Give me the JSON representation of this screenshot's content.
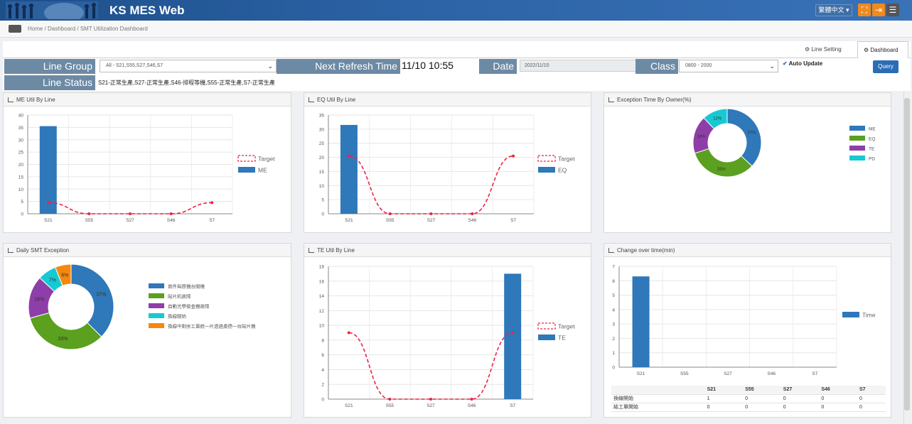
{
  "app": {
    "title": "KS MES Web",
    "language": "繁體中文",
    "colors": {
      "header": "#2c63a6",
      "bar": "#2f78b9",
      "target": "#ee2244",
      "label": "#6d8aa5"
    }
  },
  "breadcrumb": "Home /  Dashboard /  SMT Utilization Dashboard",
  "tabs": [
    {
      "label": "Line Setting",
      "icon": "gear-icon"
    },
    {
      "label": "Dashboard",
      "icon": "gear-icon"
    }
  ],
  "filters": {
    "line_group_label": "Line Group",
    "line_group_value": "All - S21,S55,S27,S46,S7",
    "next_refresh_label": "Next Refresh Time",
    "next_refresh_value": "11/10 10:55",
    "date_label": "Date",
    "date_value": "2022/11/10",
    "class_label": "Class",
    "class_value": "0800 - 2000",
    "auto_update_label": "Auto Update",
    "query_label": "Query",
    "line_status_label": "Line Status",
    "line_status_value": "S21-正常生產,S27-正常生產,S46-排程等機,S55-正常生產,S7-正常生產"
  },
  "panels": {
    "me_title": "ME Util By Line",
    "eq_title": "EQ Util By Line",
    "exc_title": "Exception Time By Owner(%)",
    "daily_title": "Daily SMT Exception",
    "te_title": "TE Util By Line",
    "cot_title": "Change over time(min)"
  },
  "chart_data": [
    {
      "type": "bar",
      "id": "me",
      "categories": [
        "S21",
        "S55",
        "S27",
        "S46",
        "S7"
      ],
      "series": [
        {
          "name": "ME",
          "kind": "bar",
          "values": [
            35.5,
            0,
            0,
            0,
            0
          ]
        },
        {
          "name": "Target",
          "kind": "line",
          "values": [
            4.5,
            0,
            0,
            0,
            4.5
          ]
        }
      ],
      "yticks": [
        "0",
        "5",
        "10",
        "15",
        "20",
        "25",
        "30",
        "35",
        "40"
      ],
      "ylim": [
        0,
        40
      ]
    },
    {
      "type": "bar",
      "id": "eq",
      "categories": [
        "S21",
        "S55",
        "S27",
        "S46",
        "S7"
      ],
      "series": [
        {
          "name": "EQ",
          "kind": "bar",
          "values": [
            31.5,
            0,
            0,
            0,
            0
          ]
        },
        {
          "name": "Target",
          "kind": "line",
          "values": [
            20.5,
            0,
            0,
            0,
            20.5
          ]
        }
      ],
      "yticks": [
        "0",
        "5",
        "10",
        "15",
        "20",
        "25",
        "30",
        "35"
      ],
      "ylim": [
        0,
        35
      ]
    },
    {
      "type": "pie",
      "id": "exc",
      "labels": [
        "ME",
        "EQ",
        "TE",
        "PD"
      ],
      "values": [
        37,
        33,
        18,
        12
      ],
      "slice_labels": [
        "37%",
        "33%",
        "18%",
        "12%"
      ],
      "colors": [
        "#2f78b9",
        "#5ba01e",
        "#8e3ea8",
        "#17c9d3"
      ]
    },
    {
      "type": "pie",
      "id": "daily",
      "labels": [
        "首件與原機台開機",
        "貼片机故障",
        "自動光學檢查機故障",
        "換線開始",
        "換線中剩余工單統一片透過奧德一台貼片機"
      ],
      "values": [
        37,
        33,
        16,
        7,
        6
      ],
      "slice_labels": [
        "37%",
        "33%",
        "16%",
        "7%",
        "6%"
      ],
      "colors": [
        "#2f78b9",
        "#5ba01e",
        "#8e3ea8",
        "#17c9d3",
        "#f7870d"
      ]
    },
    {
      "type": "bar",
      "id": "te",
      "categories": [
        "S21",
        "S55",
        "S27",
        "S46",
        "S7"
      ],
      "series": [
        {
          "name": "TE",
          "kind": "bar",
          "values": [
            0,
            0,
            0,
            0,
            17
          ]
        },
        {
          "name": "Target",
          "kind": "line",
          "values": [
            9,
            0,
            0,
            0,
            9
          ]
        }
      ],
      "yticks": [
        "0",
        "2",
        "4",
        "6",
        "8",
        "10",
        "12",
        "14",
        "16",
        "18"
      ],
      "ylim": [
        0,
        18
      ]
    },
    {
      "type": "bar",
      "id": "cot",
      "categories": [
        "S21",
        "S55",
        "S27",
        "S46",
        "S7"
      ],
      "series": [
        {
          "name": "Time",
          "kind": "bar",
          "values": [
            6.3,
            0,
            0,
            0,
            0
          ]
        }
      ],
      "yticks": [
        "0",
        "1",
        "2",
        "3",
        "4",
        "5",
        "6",
        "7"
      ],
      "ylim": [
        0,
        7
      ]
    }
  ],
  "cot_table": {
    "headers": [
      "",
      "S21",
      "S55",
      "S27",
      "S46",
      "S7"
    ],
    "rows": [
      [
        "換線開始",
        "1",
        "0",
        "0",
        "0",
        "0"
      ],
      [
        "結工單開始",
        "0",
        "0",
        "0",
        "0",
        "0"
      ]
    ]
  }
}
